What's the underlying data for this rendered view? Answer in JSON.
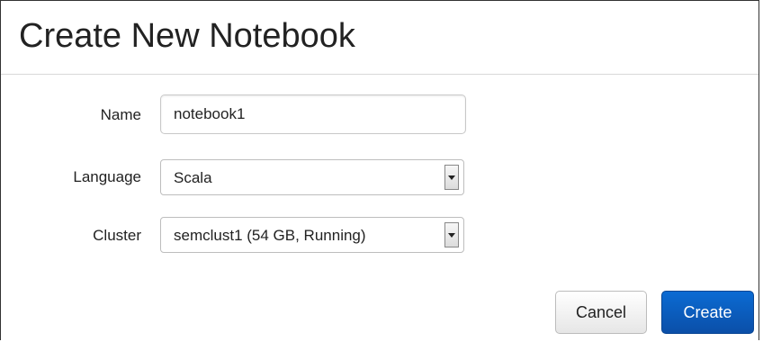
{
  "dialog": {
    "title": "Create New Notebook"
  },
  "form": {
    "name_label": "Name",
    "name_value": "notebook1",
    "language_label": "Language",
    "language_value": "Scala",
    "cluster_label": "Cluster",
    "cluster_value": "semclust1 (54 GB, Running)"
  },
  "buttons": {
    "cancel_label": "Cancel",
    "create_label": "Create"
  },
  "colors": {
    "primary": "#0b5cbf",
    "border": "#c8c8c8"
  }
}
